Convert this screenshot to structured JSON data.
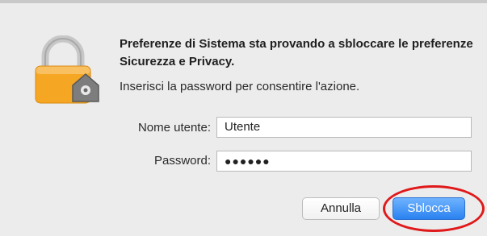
{
  "dialog": {
    "title": "Preferenze di Sistema sta provando a sbloccare le preferenze Sicurezza e Privacy.",
    "message": "Inserisci la password per consentire l'azione.",
    "icon": "lock-icon"
  },
  "form": {
    "username_label": "Nome utente:",
    "username_value": "Utente",
    "password_label": "Password:",
    "password_masked": "●●●●●●"
  },
  "buttons": {
    "cancel_label": "Annulla",
    "unlock_label": "Sblocca"
  },
  "colors": {
    "accent": "#2a82f0",
    "annotation": "#e0191b",
    "lock_body": "#f5a623"
  }
}
